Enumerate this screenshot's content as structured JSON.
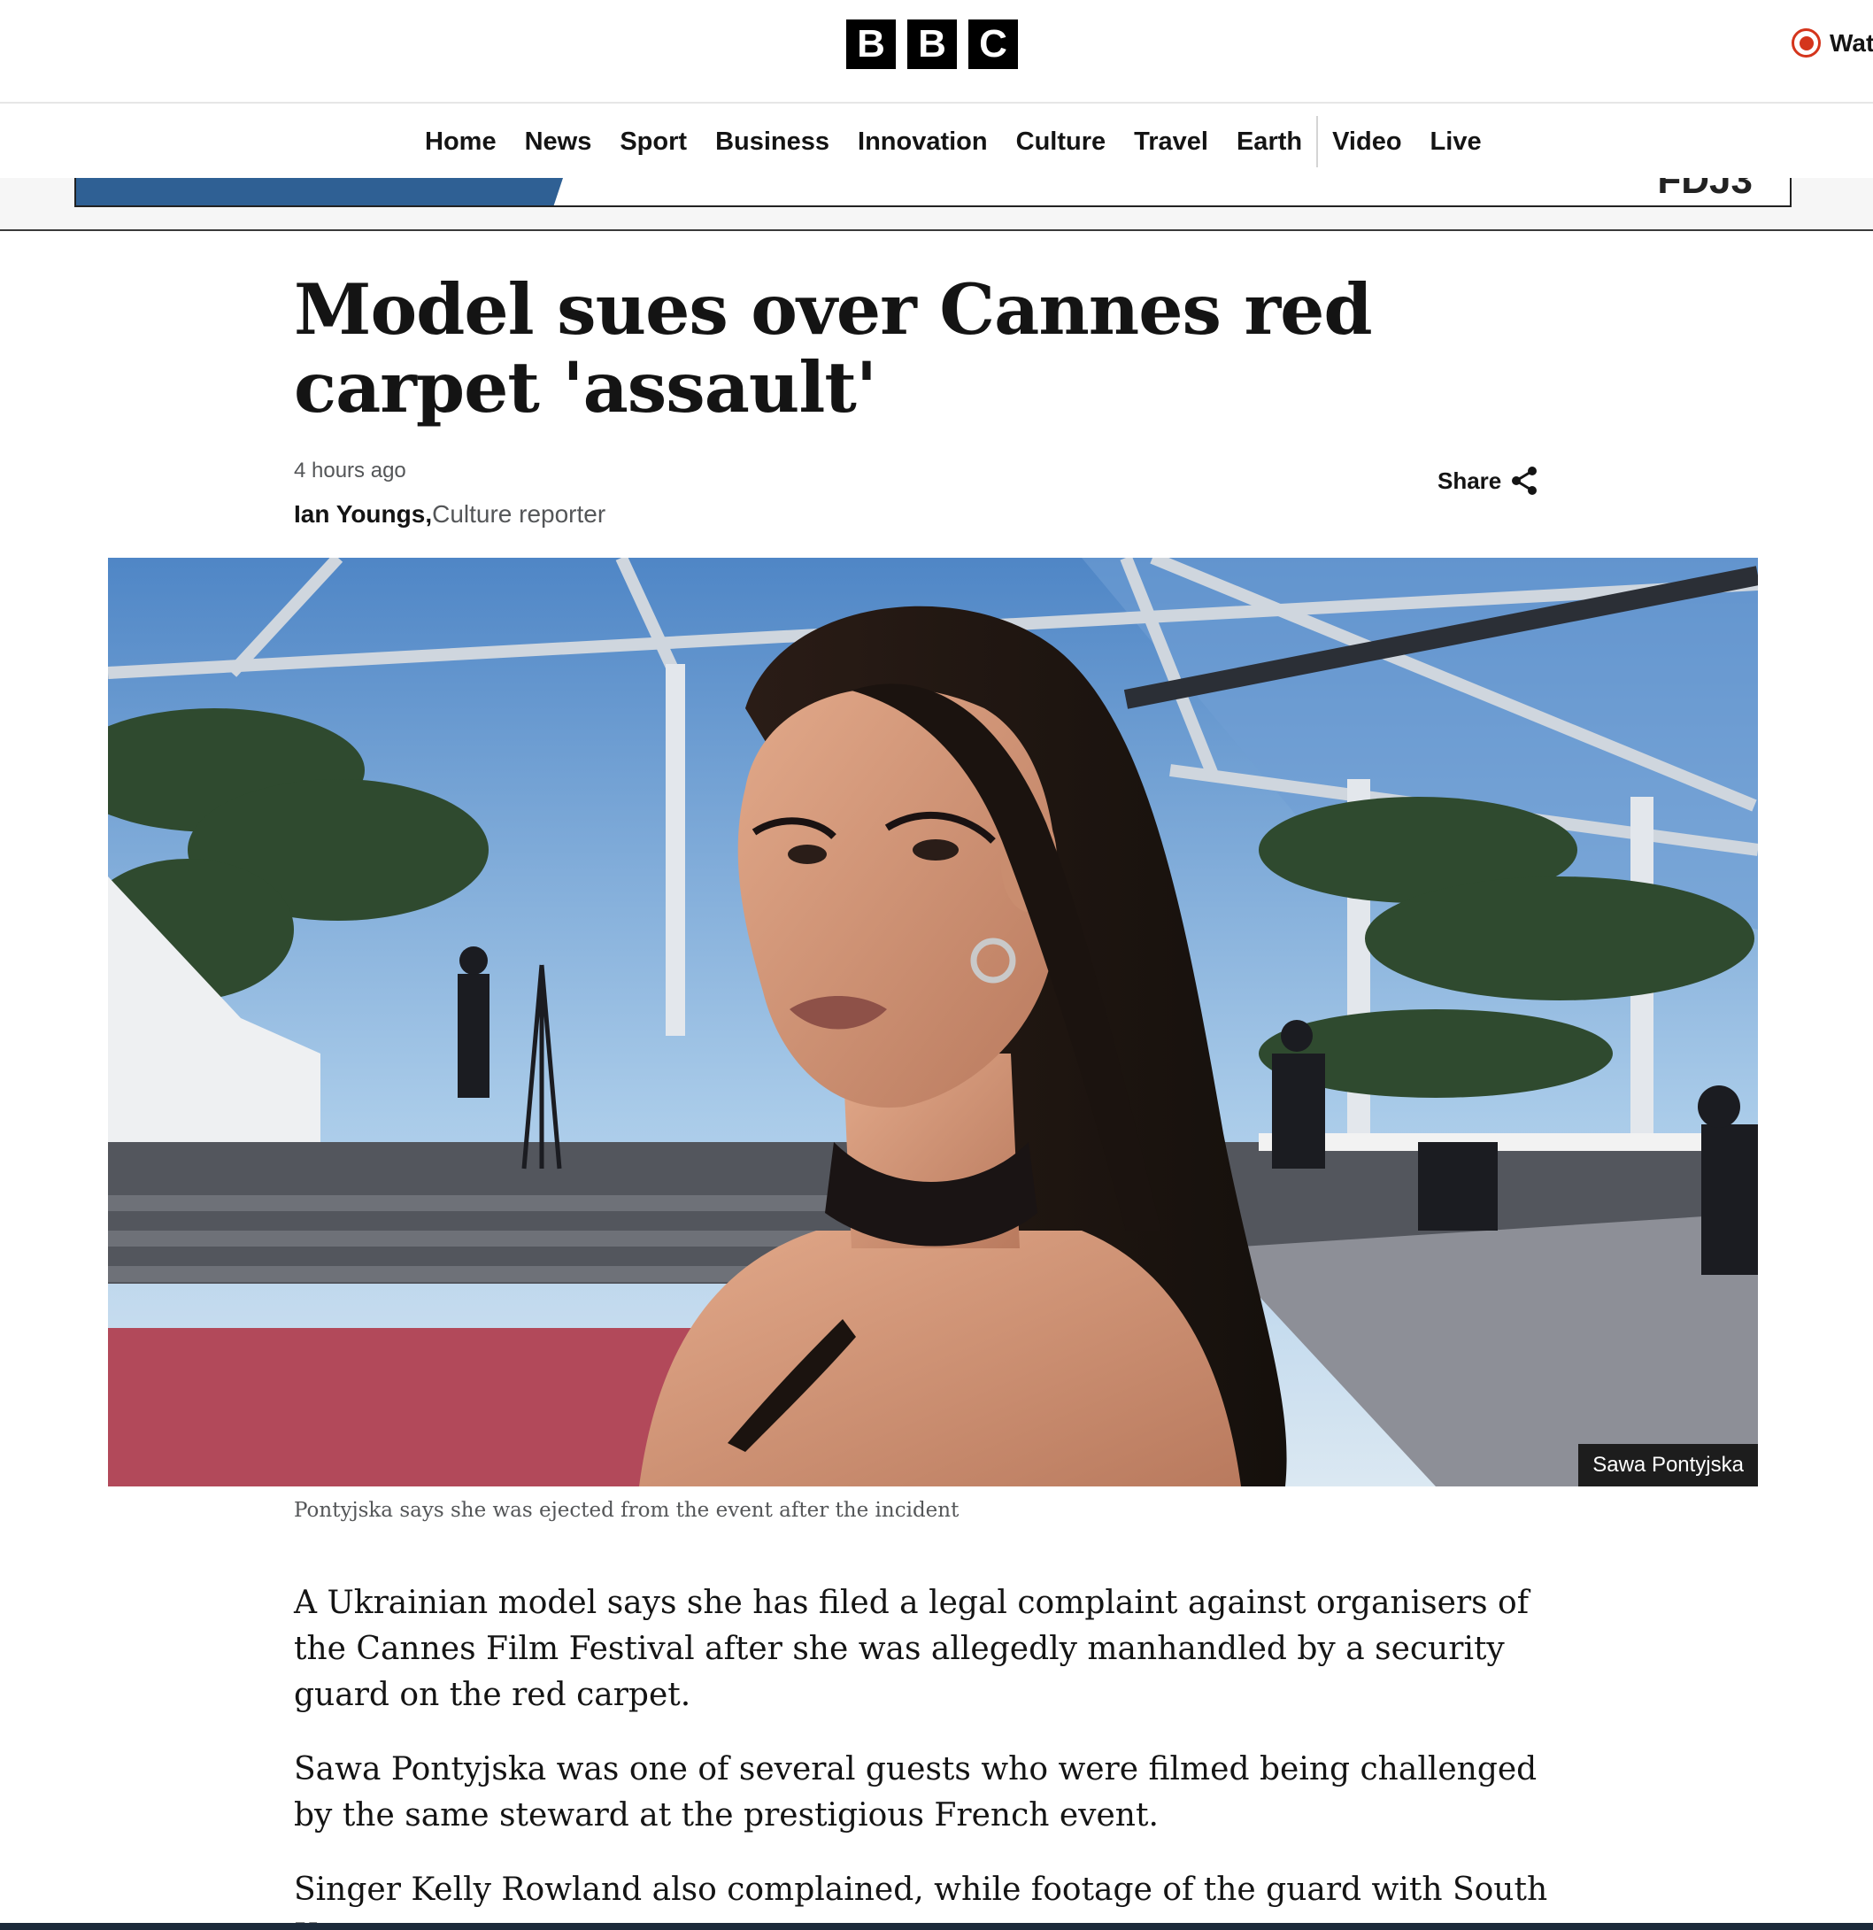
{
  "header": {
    "logo_letters": [
      "B",
      "B",
      "C"
    ],
    "watch_live_label": "Wat"
  },
  "nav": {
    "items": [
      "Home",
      "News",
      "Sport",
      "Business",
      "Innovation",
      "Culture",
      "Travel",
      "Earth"
    ],
    "items_after_divider": [
      "Video",
      "Live"
    ]
  },
  "ad": {
    "visible_text": "FDJ3"
  },
  "article": {
    "headline": "Model sues over Cannes red carpet 'assault'",
    "timestamp": "4 hours ago",
    "author_name": "Ian Youngs,",
    "author_role": "Culture reporter",
    "share_label": "Share",
    "image": {
      "credit": "Sawa Pontyjska",
      "caption": "Pontyjska says she was ejected from the event after the incident"
    },
    "paragraphs": [
      "A Ukrainian model says she has filed a legal complaint against organisers of the Cannes Film Festival after she was allegedly manhandled by a security guard on the red carpet.",
      "Sawa Pontyjska was one of several guests who were filmed being challenged by the same steward at the prestigious French event.",
      "Singer Kelly Rowland also complained, while footage of the guard with South Korean"
    ]
  },
  "colors": {
    "brand_black": "#000000",
    "live_red": "#d4351c",
    "ad_blue": "#2f6094"
  }
}
